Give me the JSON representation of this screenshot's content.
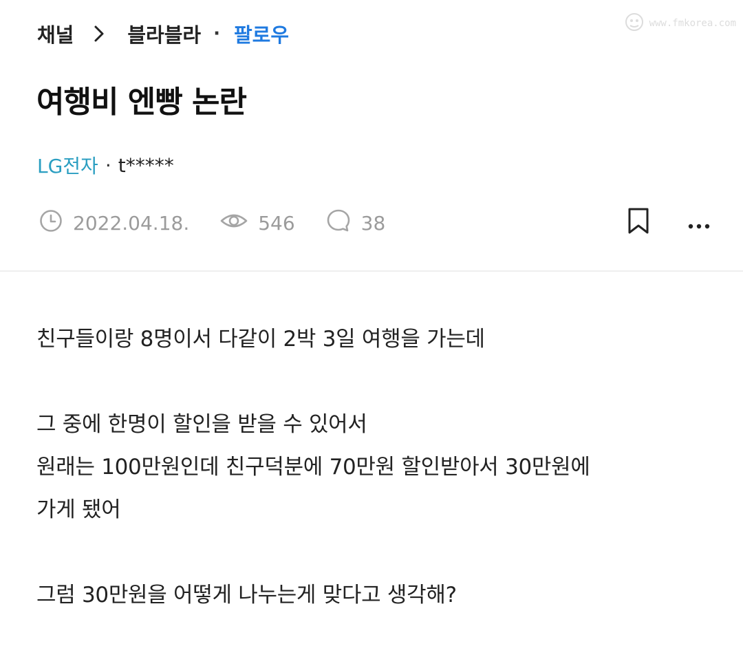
{
  "breadcrumb": {
    "channel": "채널",
    "board": "블라블라",
    "follow": "팔로우"
  },
  "watermark": "www.fmkorea.com",
  "post": {
    "title": "여행비 엔빵 논란",
    "company": "LG전자",
    "separator": "·",
    "nickname": "t*****",
    "date": "2022.04.18.",
    "views": "546",
    "comments": "38"
  },
  "body": {
    "p1": "친구들이랑 8명이서 다같이 2박 3일 여행을 가는데",
    "p2a": "그 중에 한명이 할인을 받을 수 있어서",
    "p2b": "원래는 100만원인데 친구덕분에 70만원 할인받아서 30만원에",
    "p2c": "가게 됐어",
    "p3": "그럼 30만원을 어떻게 나누는게 맞다고 생각해?"
  },
  "icons": {
    "chevron": "chevron-right-icon",
    "clock": "clock-icon",
    "eye": "eye-icon",
    "comment": "comment-bubble-icon",
    "bookmark": "bookmark-icon",
    "more": "more-horizontal-icon"
  },
  "colors": {
    "follow": "#1f7ae0",
    "company": "#2a9ec1",
    "meta": "#9b9b9b"
  }
}
